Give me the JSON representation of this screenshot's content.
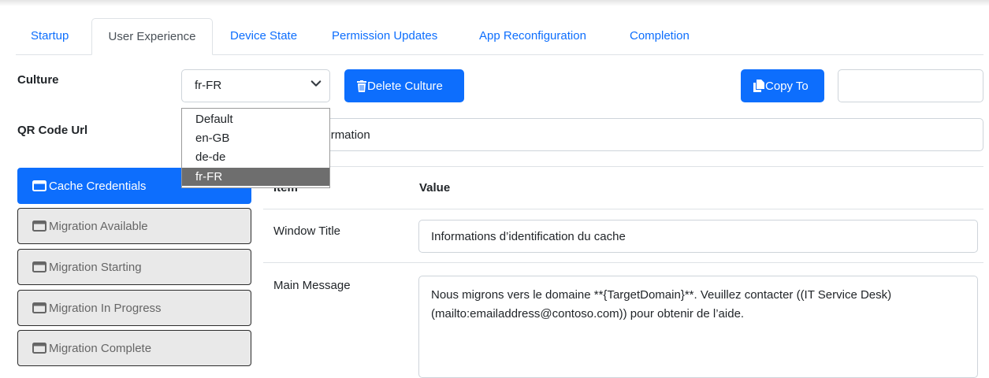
{
  "tabs": [
    {
      "label": "Startup",
      "active": false
    },
    {
      "label": "User Experience",
      "active": true
    },
    {
      "label": "Device State",
      "active": false
    },
    {
      "label": "Permission Updates",
      "active": false
    },
    {
      "label": "App Reconfiguration",
      "active": false
    },
    {
      "label": "Completion",
      "active": false
    }
  ],
  "culture": {
    "label": "Culture",
    "selected": "fr-FR",
    "options": [
      "Default",
      "en-GB",
      "de-de",
      "fr-FR"
    ],
    "delete_label": "Delete Culture",
    "copy_label": "Copy To",
    "copy_value": ""
  },
  "qr": {
    "label": "QR Code Url",
    "value": "am.com/information"
  },
  "sidebar": {
    "items": [
      {
        "label": "Cache Credentials",
        "active": true
      },
      {
        "label": "Migration Available",
        "active": false
      },
      {
        "label": "Migration Starting",
        "active": false
      },
      {
        "label": "Migration In Progress",
        "active": false
      },
      {
        "label": "Migration Complete",
        "active": false
      }
    ]
  },
  "table": {
    "header_item": "Item",
    "header_value": "Value",
    "rows": [
      {
        "item": "Window Title",
        "value": "Informations d’identification du cache"
      },
      {
        "item": "Main Message",
        "value": "Nous migrons vers le domaine **{TargetDomain}**. Veuillez contacter ((IT Service Desk)(mailto:emailaddress@contoso.com)) pour obtenir de l’aide."
      }
    ]
  },
  "colors": {
    "primary": "#0d6efd",
    "dropdown_selected": "#6e6e6e",
    "sidebar_inactive": "#e9e9e9"
  },
  "icons": {
    "delete": "trash-icon",
    "copy": "copy-icon",
    "sidebar": "window-icon",
    "select": "chevron-down-icon"
  }
}
